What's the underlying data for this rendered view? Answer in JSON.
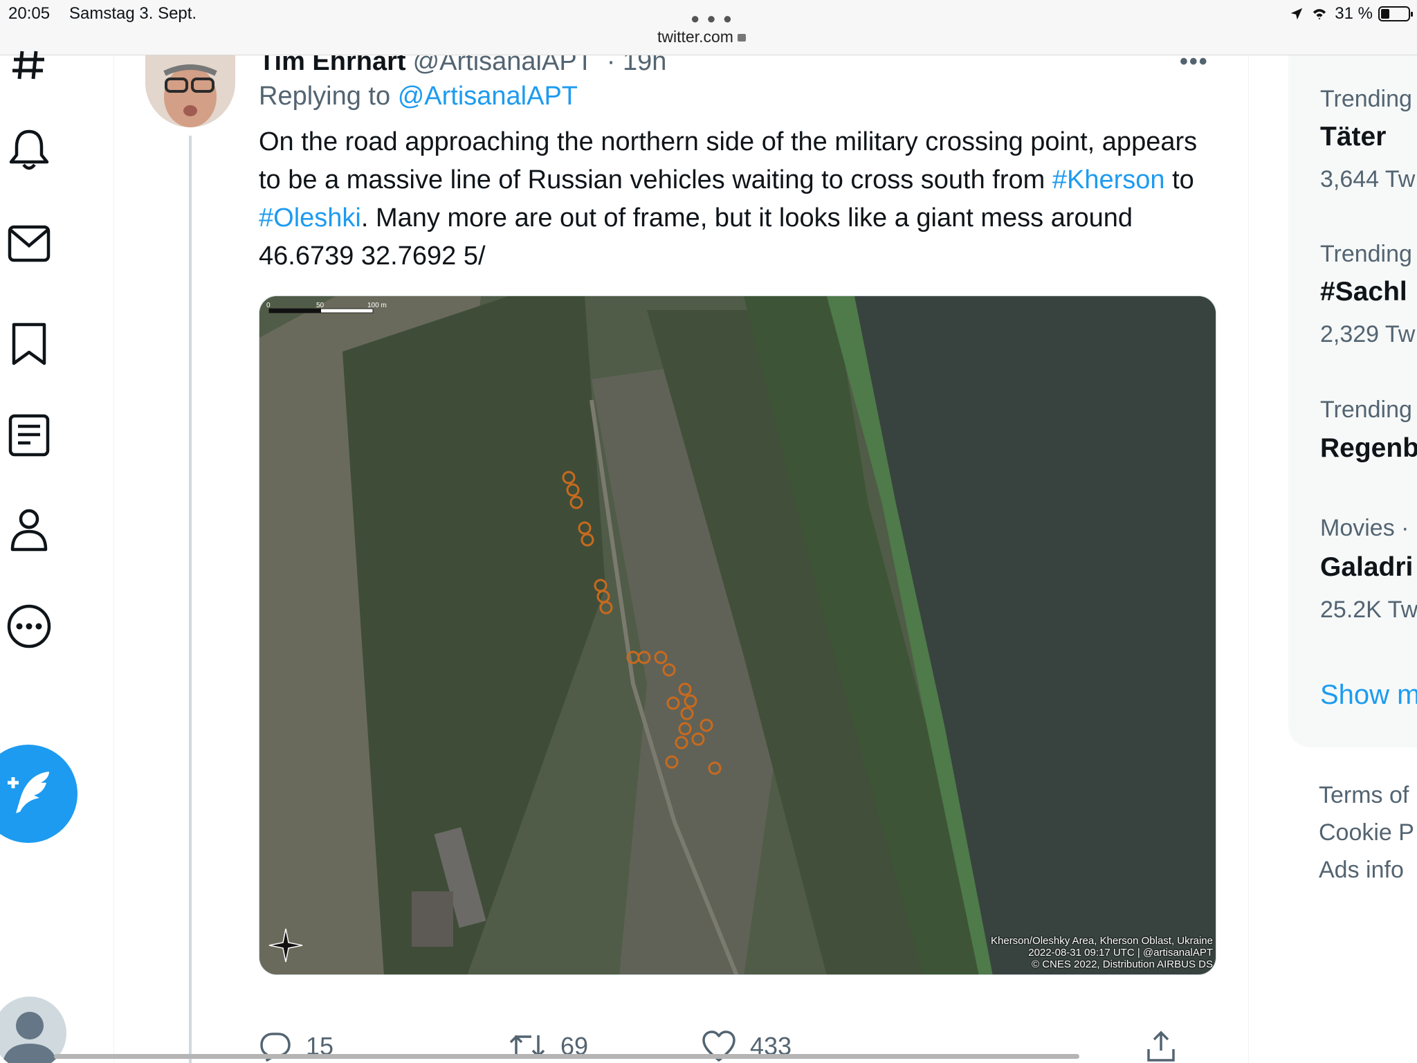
{
  "status_bar": {
    "time": "20:05",
    "date": "Samstag 3. Sept.",
    "url": "twitter.com",
    "battery": "31 %"
  },
  "nav": {
    "items": [
      "hashtag-icon",
      "bell-icon",
      "mail-icon",
      "bookmark-icon",
      "list-icon",
      "person-icon",
      "more-circle-icon"
    ],
    "compose_icon": "compose-feather-icon"
  },
  "tweet": {
    "author_name": "Tim Ehrhart",
    "author_handle": "@ArtisanalAPT",
    "time": "· 19h",
    "replying_prefix": "Replying to",
    "replying_handle": "@ArtisanalAPT",
    "text_parts": {
      "p1": "On the road approaching the northern side of the military crossing point, appears to be a massive line of Russian vehicles waiting to cross south from",
      "tag1": "#Kherson",
      "p2": "to",
      "tag2": "#Oleshki",
      "p3": ". Many more are out of frame, but it looks like a giant mess around 46.6739 32.7692 5/"
    },
    "media": {
      "scale_labels": [
        "0",
        "50",
        "100 m"
      ],
      "caption_lines": [
        "Kherson/Oleshky Area, Kherson Oblast, Ukraine",
        "2022-08-31 09:17 UTC | @artisanalAPT",
        "© CNES 2022, Distribution AIRBUS DS"
      ]
    },
    "actions": {
      "replies": "15",
      "retweets": "69",
      "likes": "433"
    }
  },
  "trends": [
    {
      "category": "Trending",
      "title": "Täter",
      "count": "3,644 Tw"
    },
    {
      "category": "Trending",
      "title": "#Sachl",
      "count": "2,329 Tw"
    },
    {
      "category": "Trending",
      "title": "Regenb",
      "count": ""
    },
    {
      "category": "Movies ·",
      "title": "Galadri",
      "count": "25.2K Tw"
    }
  ],
  "show_more": "Show m",
  "footer": [
    "Terms of",
    "Cookie P",
    "Ads info"
  ]
}
